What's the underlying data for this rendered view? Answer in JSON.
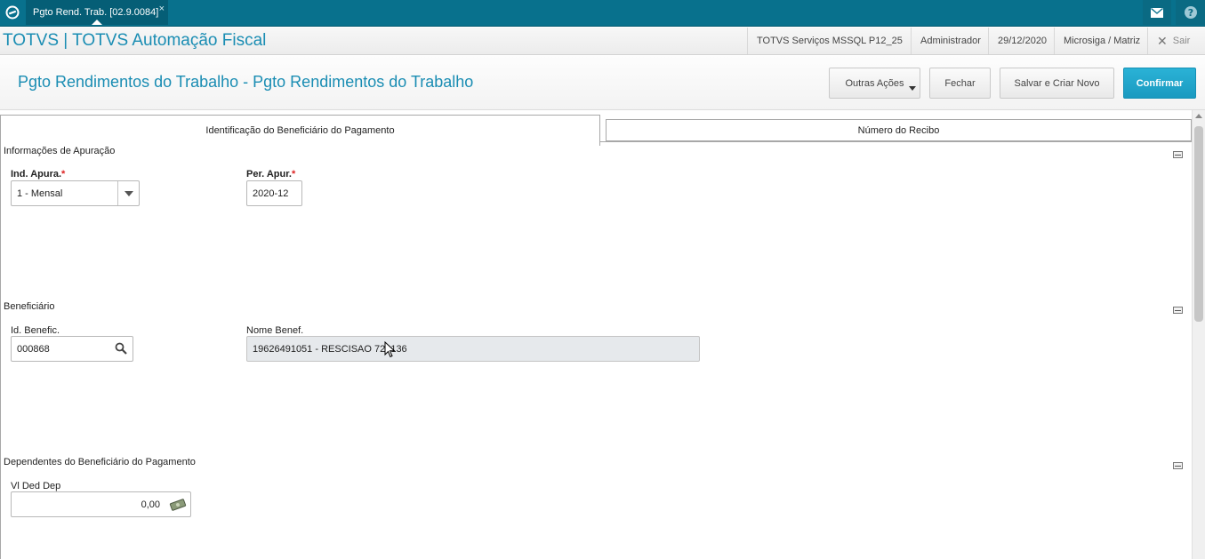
{
  "topbar": {
    "window_tab": {
      "label": "Pgto Rend. Trab. [02.9.0084]",
      "close": "×"
    },
    "icons": [
      "totvs-logo-icon",
      "mail-icon",
      "help-icon"
    ]
  },
  "header": {
    "app_title": "TOTVS | TOTVS Automação Fiscal",
    "environment": "TOTVS Serviços MSSQL P12_25",
    "user": "Administrador",
    "date": "29/12/2020",
    "company": "Microsiga / Matriz",
    "exit_label": "Sair"
  },
  "page": {
    "title": "Pgto Rendimentos do Trabalho - Pgto Rendimentos do Trabalho",
    "buttons": {
      "other_actions": "Outras Ações",
      "close": "Fechar",
      "save_new": "Salvar e Criar Novo",
      "confirm": "Confirmar"
    }
  },
  "tabs": [
    {
      "label": "Identificação do Beneficiário do Pagamento",
      "active": true
    },
    {
      "label": "Número do Recibo",
      "active": false
    }
  ],
  "sections": {
    "apuracao": {
      "title": "Informações de Apuração",
      "ind_apura": {
        "label": "Ind. Apura.",
        "required": "*",
        "value": "1 - Mensal"
      },
      "per_apur": {
        "label": "Per. Apur.",
        "required": "*",
        "value": "2020-12"
      }
    },
    "beneficiario": {
      "title": "Beneficiário",
      "id_benefic": {
        "label": "Id. Benefic.",
        "value": "000868"
      },
      "nome_benef": {
        "label": "Nome Benef.",
        "value": "19626491051 - RESCISAO 723136"
      }
    },
    "dependentes": {
      "title": "Dependentes do Beneficiário do Pagamento",
      "vl_ded_dep": {
        "label": "Vl Ded Dep",
        "value": "0,00"
      }
    }
  },
  "colors": {
    "topbar": "#08718d",
    "accent": "#1a8db3",
    "primary_button": "#1a9ac0",
    "required": "#dd2222"
  }
}
